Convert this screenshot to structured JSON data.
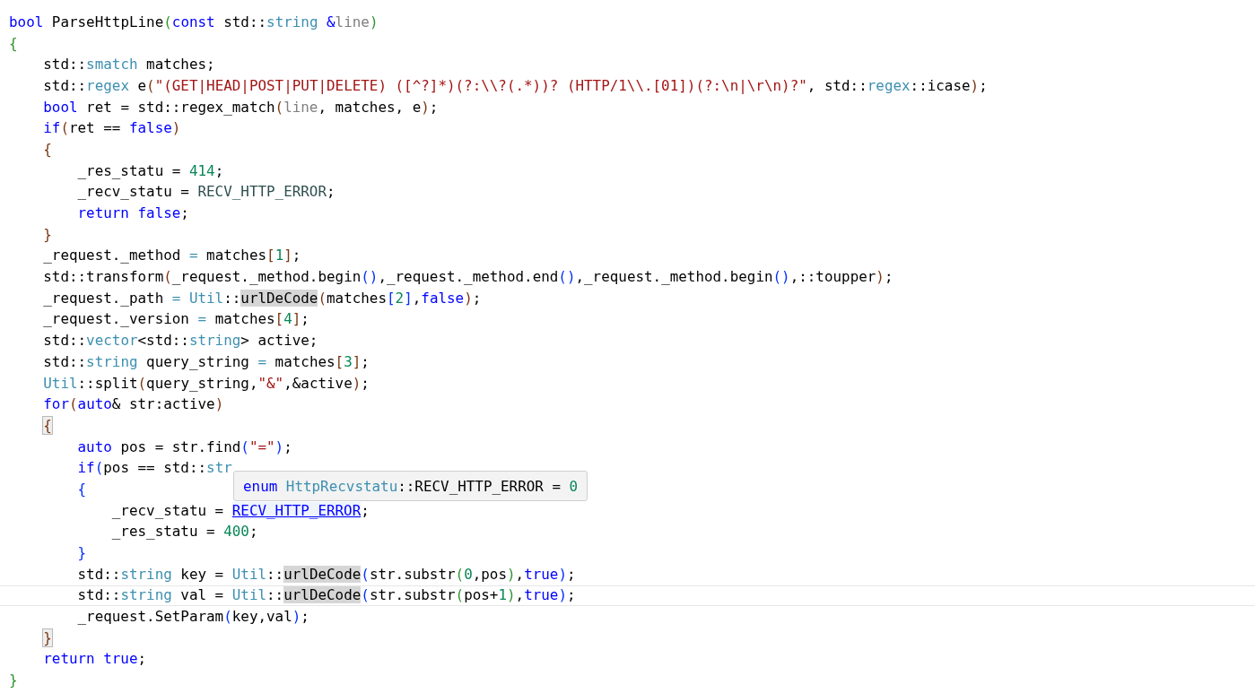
{
  "editor": {
    "lines": [
      {
        "current": false,
        "tokens": [
          {
            "kind": "keyword",
            "text": "bool"
          },
          {
            "kind": "plain",
            "text": " ParseHttpLine"
          },
          {
            "kind": "bracket3",
            "text": "("
          },
          {
            "kind": "keyword",
            "text": "const"
          },
          {
            "kind": "plain",
            "text": " std::"
          },
          {
            "kind": "type",
            "text": "string"
          },
          {
            "kind": "keyword",
            "text": " &"
          },
          {
            "kind": "param",
            "text": "line"
          },
          {
            "kind": "bracket3",
            "text": ")"
          }
        ]
      },
      {
        "current": false,
        "tokens": [
          {
            "kind": "bracket3",
            "text": "{"
          }
        ]
      },
      {
        "current": false,
        "tokens": [
          {
            "kind": "plain",
            "text": "    std::"
          },
          {
            "kind": "type",
            "text": "smatch"
          },
          {
            "kind": "plain",
            "text": " matches;"
          }
        ]
      },
      {
        "current": false,
        "tokens": [
          {
            "kind": "plain",
            "text": "    std::"
          },
          {
            "kind": "type",
            "text": "regex"
          },
          {
            "kind": "plain",
            "text": " e"
          },
          {
            "kind": "bracket1",
            "text": "("
          },
          {
            "kind": "string",
            "text": "\"(GET|HEAD|POST|PUT|DELETE) ([^?]*)(?:\\\\?(.*))? (HTTP/1\\\\.[01])(?:\\n|\\r\\n)?\""
          },
          {
            "kind": "plain",
            "text": ", std::"
          },
          {
            "kind": "type",
            "text": "regex"
          },
          {
            "kind": "plain",
            "text": "::icase"
          },
          {
            "kind": "bracket1",
            "text": ")"
          },
          {
            "kind": "plain",
            "text": ";"
          }
        ]
      },
      {
        "current": false,
        "tokens": [
          {
            "kind": "keyword",
            "text": "    bool"
          },
          {
            "kind": "plain",
            "text": " ret = std::regex_match"
          },
          {
            "kind": "bracket1",
            "text": "("
          },
          {
            "kind": "param",
            "text": "line"
          },
          {
            "kind": "plain",
            "text": ", matches, e"
          },
          {
            "kind": "bracket1",
            "text": ")"
          },
          {
            "kind": "plain",
            "text": ";"
          }
        ]
      },
      {
        "current": false,
        "tokens": [
          {
            "kind": "keyword",
            "text": "    if"
          },
          {
            "kind": "bracket1",
            "text": "("
          },
          {
            "kind": "plain",
            "text": "ret == "
          },
          {
            "kind": "keyword",
            "text": "false"
          },
          {
            "kind": "bracket1",
            "text": ")"
          }
        ]
      },
      {
        "current": false,
        "tokens": [
          {
            "kind": "bracket1",
            "text": "    {"
          }
        ]
      },
      {
        "current": false,
        "tokens": [
          {
            "kind": "plain",
            "text": "        _res_statu = "
          },
          {
            "kind": "number",
            "text": "414"
          },
          {
            "kind": "plain",
            "text": ";"
          }
        ]
      },
      {
        "current": false,
        "tokens": [
          {
            "kind": "plain",
            "text": "        _recv_statu = "
          },
          {
            "kind": "macro",
            "text": "RECV_HTTP_ERROR"
          },
          {
            "kind": "plain",
            "text": ";"
          }
        ]
      },
      {
        "current": false,
        "tokens": [
          {
            "kind": "keyword",
            "text": "        return false"
          },
          {
            "kind": "plain",
            "text": ";"
          }
        ]
      },
      {
        "current": false,
        "tokens": [
          {
            "kind": "bracket1",
            "text": "    }"
          }
        ]
      },
      {
        "current": false,
        "tokens": [
          {
            "kind": "plain",
            "text": "    _request._method "
          },
          {
            "kind": "type",
            "text": "="
          },
          {
            "kind": "plain",
            "text": " matches"
          },
          {
            "kind": "bracket1",
            "text": "["
          },
          {
            "kind": "number",
            "text": "1"
          },
          {
            "kind": "bracket1",
            "text": "]"
          },
          {
            "kind": "plain",
            "text": ";"
          }
        ]
      },
      {
        "current": false,
        "tokens": [
          {
            "kind": "plain",
            "text": "    std::transform"
          },
          {
            "kind": "bracket1",
            "text": "("
          },
          {
            "kind": "plain",
            "text": "_request._method.begin"
          },
          {
            "kind": "bracket2",
            "text": "()"
          },
          {
            "kind": "plain",
            "text": ",_request._method.end"
          },
          {
            "kind": "bracket2",
            "text": "()"
          },
          {
            "kind": "plain",
            "text": ",_request._method.begin"
          },
          {
            "kind": "bracket2",
            "text": "()"
          },
          {
            "kind": "plain",
            "text": ",::toupper"
          },
          {
            "kind": "bracket1",
            "text": ")"
          },
          {
            "kind": "plain",
            "text": ";"
          }
        ]
      },
      {
        "current": false,
        "tokens": [
          {
            "kind": "plain",
            "text": "    _request._path "
          },
          {
            "kind": "type",
            "text": "= Util"
          },
          {
            "kind": "plain",
            "text": "::"
          },
          {
            "kind": "highlight",
            "text": "urlDeCode"
          },
          {
            "kind": "bracket1",
            "text": "("
          },
          {
            "kind": "plain",
            "text": "matches"
          },
          {
            "kind": "bracket2",
            "text": "["
          },
          {
            "kind": "number",
            "text": "2"
          },
          {
            "kind": "bracket2",
            "text": "]"
          },
          {
            "kind": "plain",
            "text": ","
          },
          {
            "kind": "keyword",
            "text": "false"
          },
          {
            "kind": "bracket1",
            "text": ")"
          },
          {
            "kind": "plain",
            "text": ";"
          }
        ]
      },
      {
        "current": false,
        "tokens": [
          {
            "kind": "plain",
            "text": "    _request._version "
          },
          {
            "kind": "type",
            "text": "="
          },
          {
            "kind": "plain",
            "text": " matches"
          },
          {
            "kind": "bracket1",
            "text": "["
          },
          {
            "kind": "number",
            "text": "4"
          },
          {
            "kind": "bracket1",
            "text": "]"
          },
          {
            "kind": "plain",
            "text": ";"
          }
        ]
      },
      {
        "current": false,
        "tokens": [
          {
            "kind": "plain",
            "text": "    std::"
          },
          {
            "kind": "type",
            "text": "vector"
          },
          {
            "kind": "plain",
            "text": "<std::"
          },
          {
            "kind": "type",
            "text": "string"
          },
          {
            "kind": "plain",
            "text": "> active;"
          }
        ]
      },
      {
        "current": false,
        "tokens": [
          {
            "kind": "plain",
            "text": "    std::"
          },
          {
            "kind": "type",
            "text": "string"
          },
          {
            "kind": "plain",
            "text": " query_string "
          },
          {
            "kind": "type",
            "text": "="
          },
          {
            "kind": "plain",
            "text": " matches"
          },
          {
            "kind": "bracket1",
            "text": "["
          },
          {
            "kind": "number",
            "text": "3"
          },
          {
            "kind": "bracket1",
            "text": "]"
          },
          {
            "kind": "plain",
            "text": ";"
          }
        ]
      },
      {
        "current": false,
        "tokens": [
          {
            "kind": "type",
            "text": "    Util"
          },
          {
            "kind": "plain",
            "text": "::split"
          },
          {
            "kind": "bracket1",
            "text": "("
          },
          {
            "kind": "plain",
            "text": "query_string,"
          },
          {
            "kind": "string",
            "text": "\"&\""
          },
          {
            "kind": "plain",
            "text": ",&active"
          },
          {
            "kind": "bracket1",
            "text": ")"
          },
          {
            "kind": "plain",
            "text": ";"
          }
        ]
      },
      {
        "current": false,
        "tokens": [
          {
            "kind": "keyword",
            "text": "    for"
          },
          {
            "kind": "bracket1",
            "text": "("
          },
          {
            "kind": "keyword",
            "text": "auto"
          },
          {
            "kind": "plain",
            "text": "& str:active"
          },
          {
            "kind": "bracket1",
            "text": ")"
          }
        ]
      },
      {
        "current": false,
        "tokens": [
          {
            "kind": "brace-match",
            "text": "    {"
          }
        ]
      },
      {
        "current": false,
        "tokens": [
          {
            "kind": "keyword",
            "text": "        auto"
          },
          {
            "kind": "plain",
            "text": " pos = str.find"
          },
          {
            "kind": "bracket2",
            "text": "("
          },
          {
            "kind": "string",
            "text": "\"=\""
          },
          {
            "kind": "bracket2",
            "text": ")"
          },
          {
            "kind": "plain",
            "text": ";"
          }
        ]
      },
      {
        "current": false,
        "tokens": [
          {
            "kind": "keyword",
            "text": "        if"
          },
          {
            "kind": "bracket2",
            "text": "("
          },
          {
            "kind": "plain",
            "text": "pos == std::"
          },
          {
            "kind": "type",
            "text": "str"
          }
        ]
      },
      {
        "current": false,
        "tokens": [
          {
            "kind": "bracket2",
            "text": "        {"
          }
        ]
      },
      {
        "current": false,
        "tokens": [
          {
            "kind": "plain",
            "text": "            _recv_statu = "
          },
          {
            "kind": "link",
            "text": "RECV_HTTP_ERROR"
          },
          {
            "kind": "plain",
            "text": ";"
          }
        ]
      },
      {
        "current": false,
        "tokens": [
          {
            "kind": "plain",
            "text": "            _res_statu = "
          },
          {
            "kind": "number",
            "text": "400"
          },
          {
            "kind": "plain",
            "text": ";"
          }
        ]
      },
      {
        "current": false,
        "tokens": [
          {
            "kind": "bracket2",
            "text": "        }"
          }
        ]
      },
      {
        "current": false,
        "tokens": [
          {
            "kind": "plain",
            "text": "        std::"
          },
          {
            "kind": "type",
            "text": "string"
          },
          {
            "kind": "plain",
            "text": " key = "
          },
          {
            "kind": "type",
            "text": "Util"
          },
          {
            "kind": "plain",
            "text": "::"
          },
          {
            "kind": "highlight",
            "text": "urlDeCode"
          },
          {
            "kind": "bracket2",
            "text": "("
          },
          {
            "kind": "plain",
            "text": "str.substr"
          },
          {
            "kind": "bracket3",
            "text": "("
          },
          {
            "kind": "number",
            "text": "0"
          },
          {
            "kind": "plain",
            "text": ",pos"
          },
          {
            "kind": "bracket3",
            "text": ")"
          },
          {
            "kind": "plain",
            "text": ","
          },
          {
            "kind": "keyword",
            "text": "true"
          },
          {
            "kind": "bracket2",
            "text": ")"
          },
          {
            "kind": "plain",
            "text": ";"
          }
        ]
      },
      {
        "current": true,
        "tokens": [
          {
            "kind": "plain",
            "text": "        std::"
          },
          {
            "kind": "type",
            "text": "string"
          },
          {
            "kind": "plain",
            "text": " val = "
          },
          {
            "kind": "type",
            "text": "Util"
          },
          {
            "kind": "plain",
            "text": "::"
          },
          {
            "kind": "highlight",
            "text": "urlDeCode"
          },
          {
            "kind": "bracket2",
            "text": "("
          },
          {
            "kind": "plain",
            "text": "str.substr"
          },
          {
            "kind": "bracket3",
            "text": "("
          },
          {
            "kind": "plain",
            "text": "pos+"
          },
          {
            "kind": "number",
            "text": "1"
          },
          {
            "kind": "bracket3",
            "text": ")"
          },
          {
            "kind": "plain",
            "text": ","
          },
          {
            "kind": "keyword",
            "text": "true"
          },
          {
            "kind": "bracket2",
            "text": ")"
          },
          {
            "kind": "plain",
            "text": ";"
          }
        ]
      },
      {
        "current": false,
        "tokens": [
          {
            "kind": "plain",
            "text": "        _request.SetParam"
          },
          {
            "kind": "bracket2",
            "text": "("
          },
          {
            "kind": "plain",
            "text": "key,val"
          },
          {
            "kind": "bracket2",
            "text": ")"
          },
          {
            "kind": "plain",
            "text": ";"
          }
        ]
      },
      {
        "current": false,
        "tokens": [
          {
            "kind": "brace-match",
            "text": "    }"
          }
        ]
      },
      {
        "current": false,
        "tokens": [
          {
            "kind": "keyword",
            "text": "    return true"
          },
          {
            "kind": "plain",
            "text": ";"
          }
        ]
      },
      {
        "current": false,
        "tokens": [
          {
            "kind": "bracket3",
            "text": "}"
          }
        ]
      }
    ]
  },
  "tooltip": {
    "tokens": [
      {
        "kind": "keyword",
        "text": "enum"
      },
      {
        "kind": "type",
        "text": " HttpRecvstatu"
      },
      {
        "kind": "plain",
        "text": "::RECV_HTTP_ERROR = "
      },
      {
        "kind": "number",
        "text": "0"
      }
    ]
  }
}
